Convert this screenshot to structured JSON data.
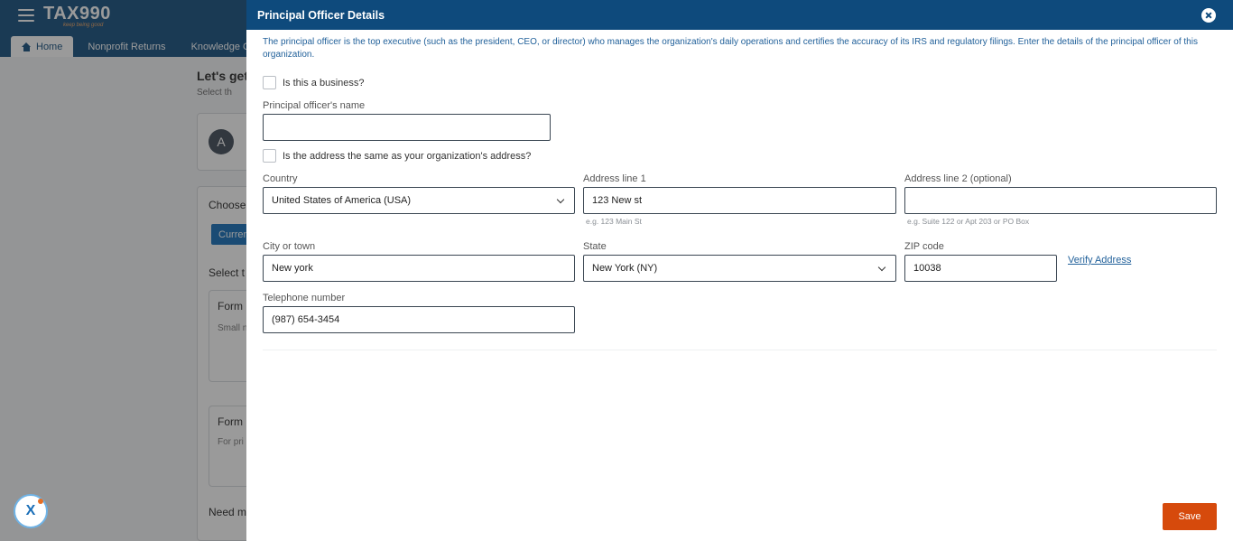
{
  "background": {
    "logo": "TAX990",
    "logo_tagline": "keep being good",
    "tabs": [
      "Home",
      "Nonprofit Returns",
      "Knowledge C"
    ],
    "heading": "Let's get",
    "subheading": "Select th",
    "avatar_letter": "A",
    "choose_label": "Choose",
    "current_button": "Curren",
    "select_label": "Select t",
    "form1_title": "Form",
    "form1_sub": "Small n",
    "form2_title": "Form",
    "form2_sub": "For pri",
    "need_label": "Need m",
    "chat_label": "X"
  },
  "drawer": {
    "title": "Principal Officer Details",
    "intro": "The principal officer is the top executive (such as the president, CEO, or director) who manages the organization's daily operations and certifies the accuracy of its IRS and regulatory filings. Enter the details of the principal officer of this organization.",
    "is_business_label": "Is this a business?",
    "officer_name_label": "Principal officer's name",
    "officer_name_value": "",
    "same_address_label": "Is the address the same as your organization's address?",
    "country_label": "Country",
    "country_value": "United States of America (USA)",
    "address1_label": "Address line 1",
    "address1_value": "123 New st",
    "address1_hint": "e.g. 123 Main St",
    "address2_label": "Address line 2 (optional)",
    "address2_value": "",
    "address2_hint": "e.g. Suite 122 or Apt 203 or PO Box",
    "city_label": "City or town",
    "city_value": "New york",
    "state_label": "State",
    "state_value": "New York (NY)",
    "zip_label": "ZIP code",
    "zip_value": "10038",
    "verify_link": "Verify Address",
    "phone_label": "Telephone number",
    "phone_value": "(987) 654-3454",
    "save_label": "Save"
  },
  "colors": {
    "header": "#0e4a7c",
    "intro_text": "#1f5f99",
    "save": "#d64a0c"
  }
}
